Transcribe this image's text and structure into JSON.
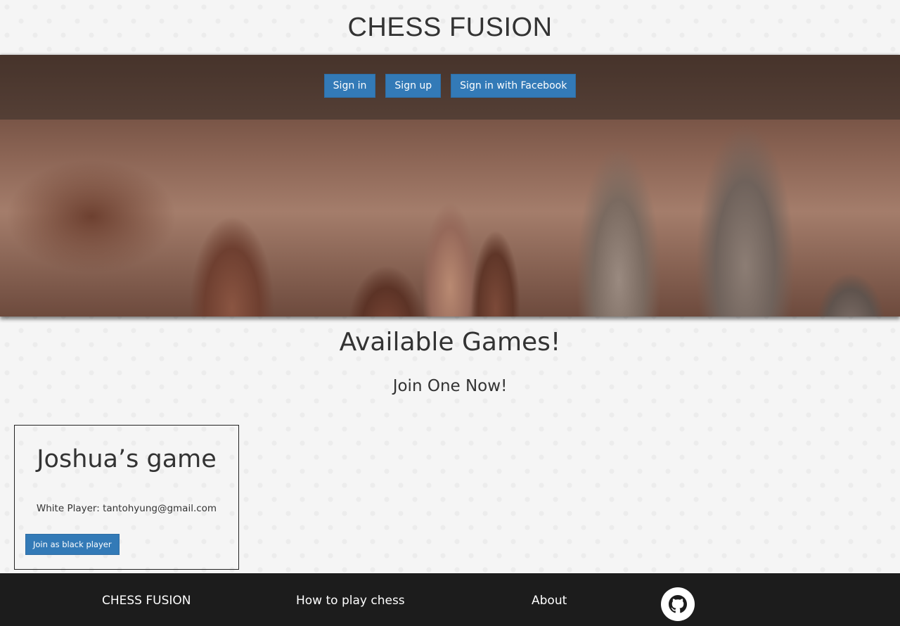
{
  "header": {
    "title": "CHESS FUSION"
  },
  "auth": {
    "sign_in": "Sign in",
    "sign_up": "Sign up",
    "facebook": "Sign in with Facebook"
  },
  "games_section": {
    "title": "Available Games!",
    "subtitle": "Join One Now!",
    "games": [
      {
        "title": "Joshua’s game",
        "white_player": "White Player: tantohyung@gmail.com",
        "join_label": "Join as black player"
      }
    ]
  },
  "footer": {
    "brand": "CHESS FUSION",
    "how_to": "How to play chess",
    "about": "About",
    "github_icon": "github-icon"
  },
  "colors": {
    "button": "#337ab7",
    "footer_bg": "#1c1c1c"
  }
}
